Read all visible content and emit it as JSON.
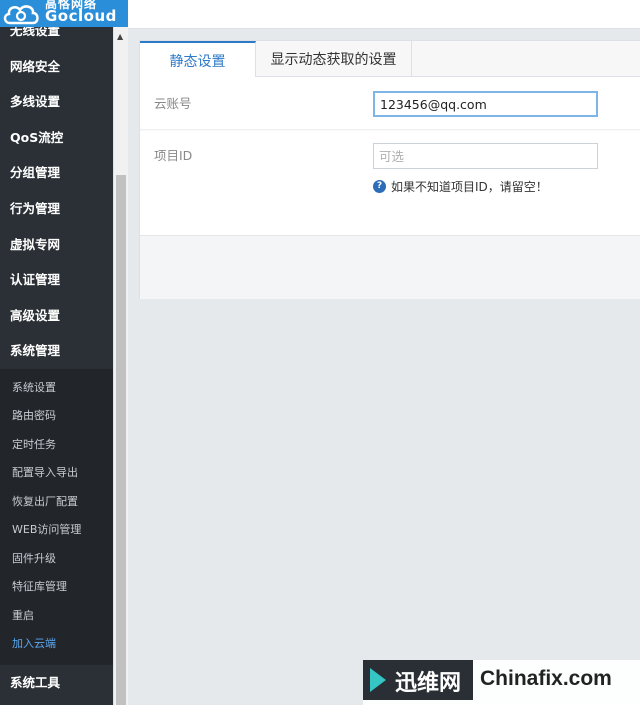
{
  "logo": {
    "cn": "高恪网络",
    "en": "Gocloud"
  },
  "sidebar": {
    "items": [
      {
        "label": "无线设置"
      },
      {
        "label": "网络安全"
      },
      {
        "label": "多线设置"
      },
      {
        "label": "QoS流控"
      },
      {
        "label": "分组管理"
      },
      {
        "label": "行为管理"
      },
      {
        "label": "虚拟专网"
      },
      {
        "label": "认证管理"
      },
      {
        "label": "高级设置"
      },
      {
        "label": "系统管理"
      }
    ],
    "subitems": [
      {
        "label": "系统设置"
      },
      {
        "label": "路由密码"
      },
      {
        "label": "定时任务"
      },
      {
        "label": "配置导入导出"
      },
      {
        "label": "恢复出厂配置"
      },
      {
        "label": "WEB访问管理"
      },
      {
        "label": "固件升级"
      },
      {
        "label": "特征库管理"
      },
      {
        "label": "重启"
      },
      {
        "label": "加入云端"
      }
    ],
    "bottom_item": {
      "label": "系统工具"
    }
  },
  "tabs": [
    {
      "label": "静态设置"
    },
    {
      "label": "显示动态获取的设置"
    }
  ],
  "form": {
    "account_label": "云账号",
    "account_value": "123456@qq.com",
    "project_label": "项目ID",
    "project_placeholder": "可选",
    "project_value": "",
    "hint": "如果不知道项目ID，请留空！",
    "help_icon": "question-circle-icon"
  },
  "watermark": {
    "cn": "迅维网",
    "en": "Chinafix.com"
  },
  "colors": {
    "accent": "#2d7ac9",
    "sidebar_bg": "#2b3036",
    "logo_bg": "#2a8fd8",
    "active_sub": "#5ba7f0"
  }
}
